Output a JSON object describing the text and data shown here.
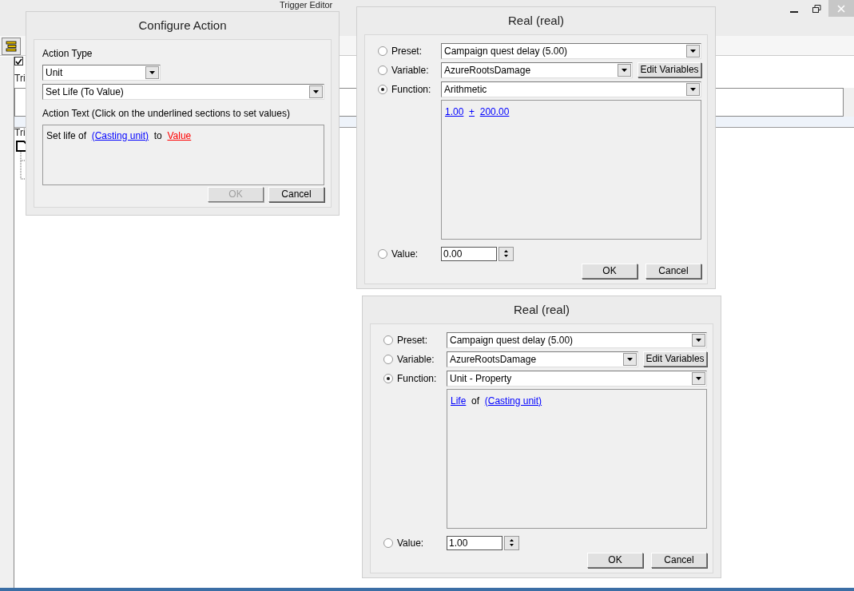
{
  "window": {
    "title": "Trigger Editor"
  },
  "background": {
    "enabled_checked": true,
    "labels": [
      "Tri",
      "Tri"
    ]
  },
  "configure_action": {
    "title": "Configure Action",
    "action_type_label": "Action Type",
    "category": "Unit",
    "action": "Set Life (To Value)",
    "action_text_label": "Action Text (Click on the underlined sections to set values)",
    "action_text": [
      {
        "kind": "text",
        "text": "Set life of"
      },
      {
        "kind": "link",
        "text": "(Casting unit)",
        "set": true
      },
      {
        "kind": "text",
        "text": "to"
      },
      {
        "kind": "link",
        "text": "Value",
        "set": false
      }
    ],
    "buttons": [
      {
        "label": "OK",
        "disabled": true
      },
      {
        "label": "Cancel",
        "disabled": false
      }
    ]
  },
  "real_dialogs": [
    {
      "title": "Real (real)",
      "options": [
        {
          "kind": "dropdown",
          "label": "Preset:",
          "value": "Campaign quest delay (5.00)",
          "selected": false
        },
        {
          "kind": "variable",
          "label": "Variable:",
          "value": "AzureRootsDamage",
          "button": "Edit Variables",
          "selected": false
        },
        {
          "kind": "dropdown",
          "label": "Function:",
          "value": "Arithmetic",
          "selected": true
        },
        {
          "kind": "spinner",
          "label": "Value:",
          "value": "0.00",
          "selected": false
        }
      ],
      "expression": [
        {
          "kind": "link",
          "text": "1.00"
        },
        {
          "kind": "link",
          "text": "+"
        },
        {
          "kind": "link",
          "text": "200.00"
        }
      ],
      "buttons": [
        {
          "label": "OK",
          "disabled": false
        },
        {
          "label": "Cancel",
          "disabled": false
        }
      ]
    },
    {
      "title": "Real (real)",
      "options": [
        {
          "kind": "dropdown",
          "label": "Preset:",
          "value": "Campaign quest delay (5.00)",
          "selected": false
        },
        {
          "kind": "variable",
          "label": "Variable:",
          "value": "AzureRootsDamage",
          "button": "Edit Variables",
          "selected": false
        },
        {
          "kind": "dropdown",
          "label": "Function:",
          "value": "Unit - Property",
          "selected": true
        },
        {
          "kind": "spinner",
          "label": "Value:",
          "value": "1.00",
          "selected": false
        }
      ],
      "expression": [
        {
          "kind": "link",
          "text": "Life"
        },
        {
          "kind": "text",
          "text": "of"
        },
        {
          "kind": "link",
          "text": "(Casting unit)"
        }
      ],
      "buttons": [
        {
          "label": "OK",
          "disabled": false
        },
        {
          "label": "Cancel",
          "disabled": false
        }
      ]
    }
  ]
}
